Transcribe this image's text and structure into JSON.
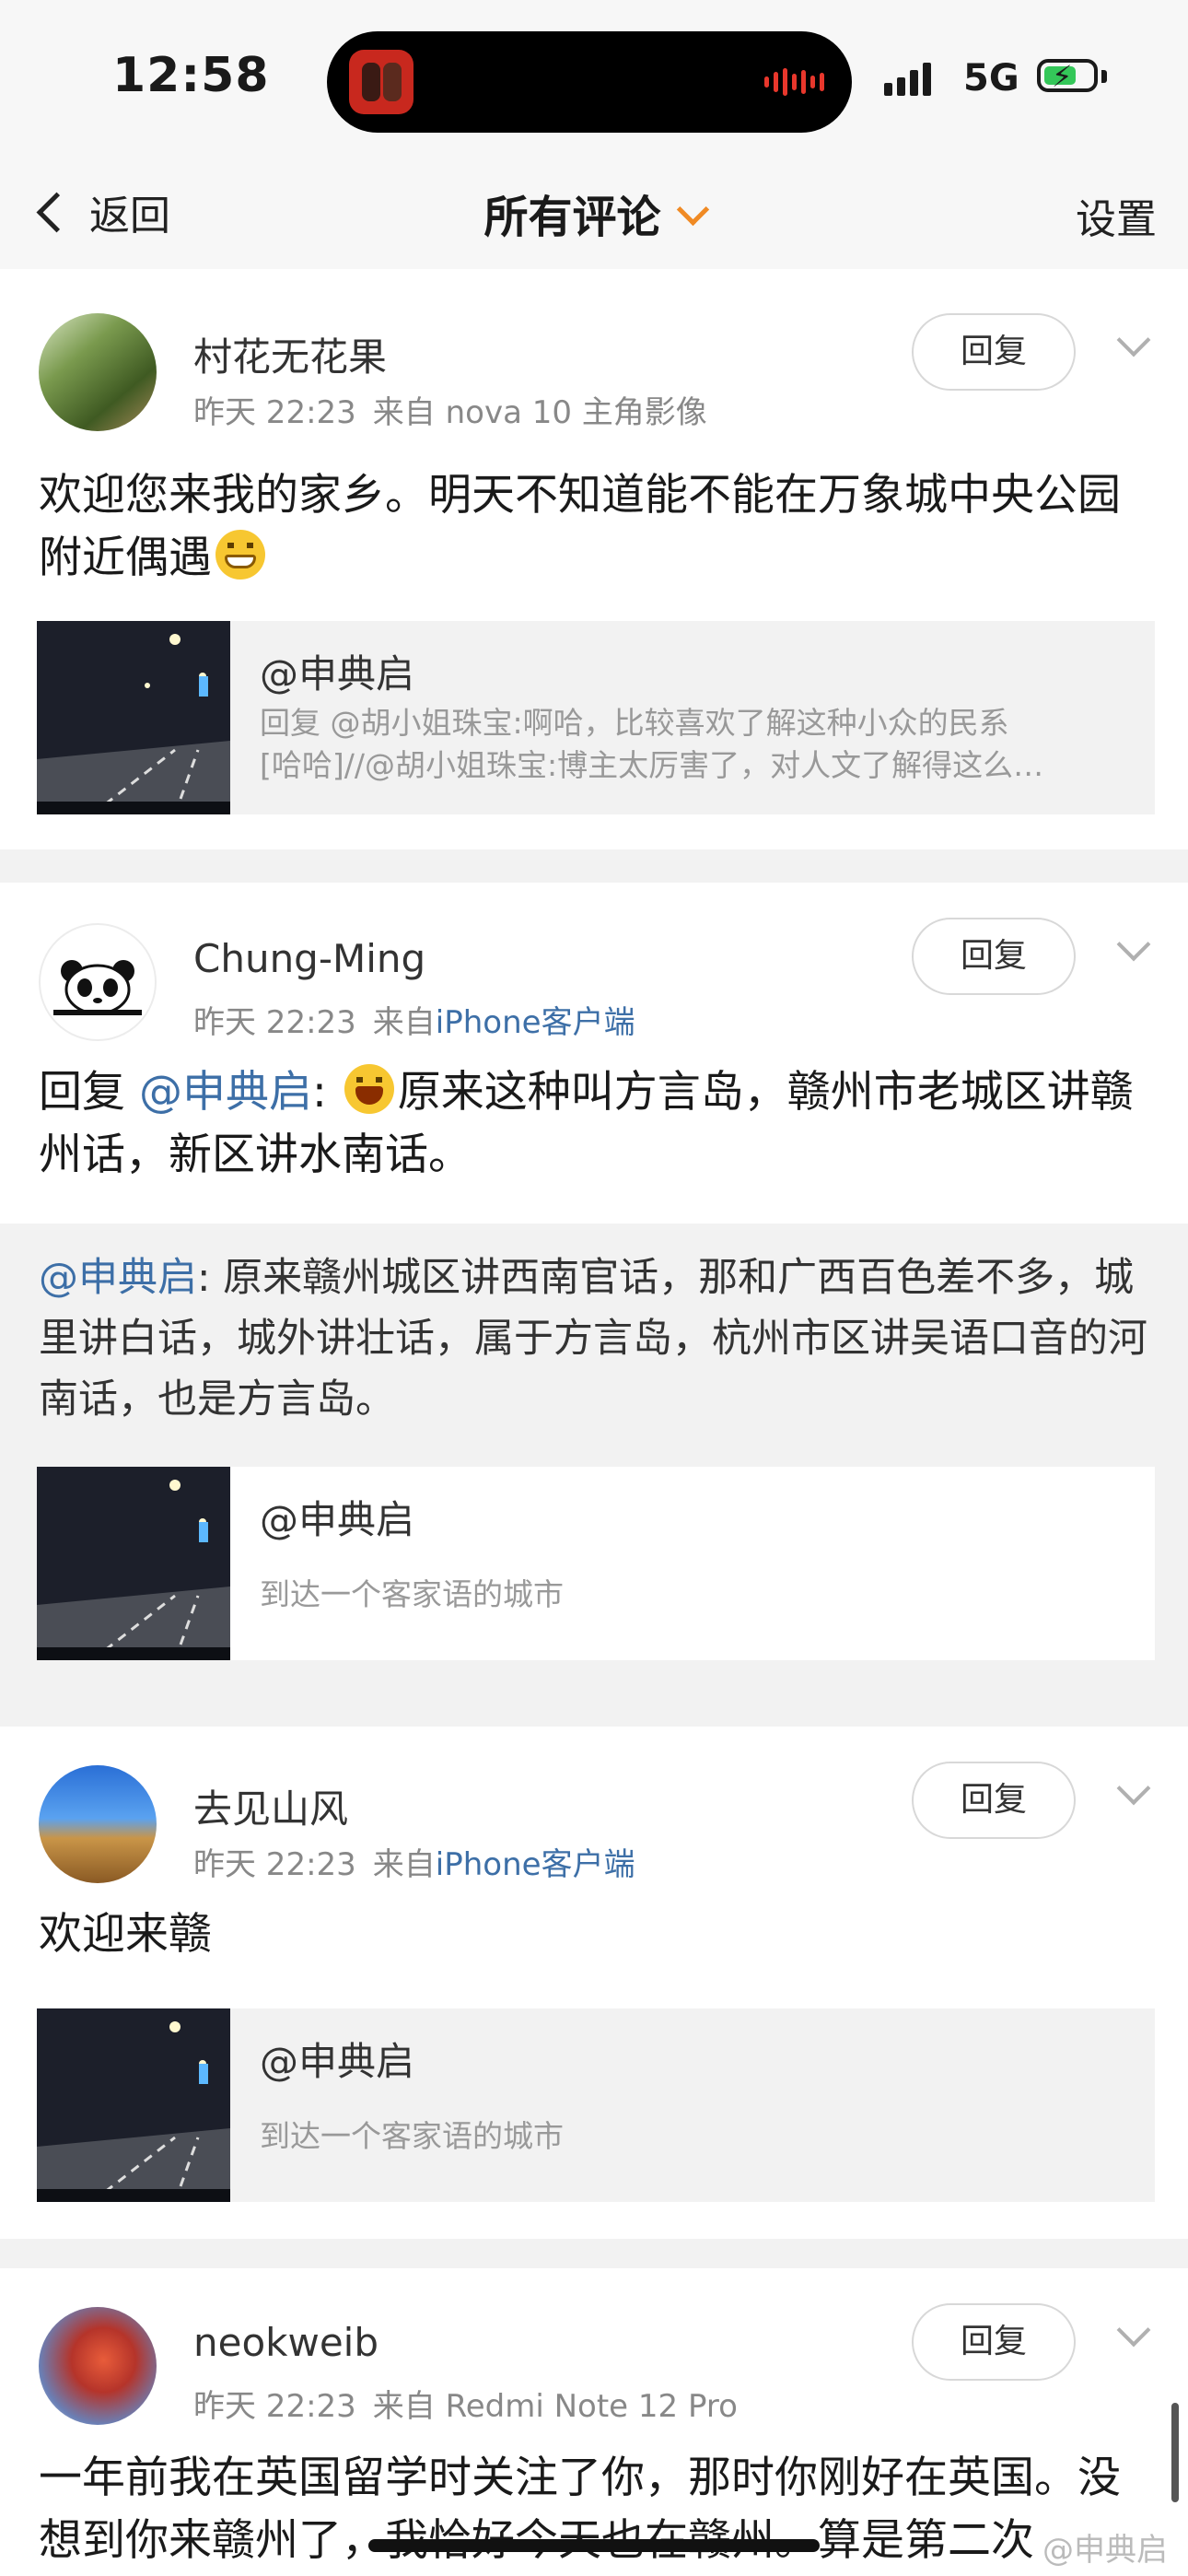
{
  "status": {
    "time": "12:58",
    "network": "5G"
  },
  "nav": {
    "back": "返回",
    "title": "所有评论",
    "settings": "设置"
  },
  "comments": [
    {
      "user": "村花无花果",
      "time": "昨天 22:23",
      "source_prefix": "来自",
      "source": "nova 10 主角影像",
      "reply": "回复",
      "text": "欢迎您来我的家乡。明天不知道能不能在万象城中央公园附近偶遇",
      "share": {
        "title": "@申典启",
        "sub1": "回复 @胡小姐珠宝:啊哈，比较喜欢了解这种小众的民系",
        "sub2": "[哈哈]//@胡小姐珠宝:博主太厉害了，对人文了解得这么…"
      }
    },
    {
      "user": "Chung-Ming",
      "time": "昨天 22:23",
      "source_prefix": "来自",
      "source": "iPhone客户端",
      "reply": "回复",
      "text_prefix": "回复 ",
      "mention": "@申典启",
      "text_colon": ": ",
      "text": "原来这种叫方言岛，赣州市老城区讲赣州话，新区讲水南话。",
      "quote_mention": "@申典启",
      "quote_text": ": 原来赣州城区讲西南官话，那和广西百色差不多，城里讲白话，城外讲壮话，属于方言岛，杭州市区讲吴语口音的河南话，也是方言岛。",
      "share": {
        "title": "@申典启",
        "sub1": "到达一个客家语的城市"
      }
    },
    {
      "user": "去见山风",
      "time": "昨天 22:23",
      "source_prefix": "来自",
      "source": "iPhone客户端",
      "reply": "回复",
      "text": "欢迎来赣",
      "share": {
        "title": "@申典启",
        "sub1": "到达一个客家语的城市"
      }
    },
    {
      "user": "neokweib",
      "time": "昨天 22:23",
      "source_prefix": "来自",
      "source": "Redmi Note 12 Pro",
      "reply": "回复",
      "text": "一年前我在英国留学时关注了你，那时你刚好在英国。没想到你来赣州了，我恰好今天也在赣州。算是第二次"
    }
  ],
  "watermark": "@申典启",
  "colors": {
    "accent": "#f08a24",
    "link": "#3d6fa7",
    "background": "#f2f2f2"
  },
  "icons": {
    "back": "chevron-left-icon",
    "title_caret": "chevron-down-icon",
    "menu": "chevron-down-icon"
  }
}
